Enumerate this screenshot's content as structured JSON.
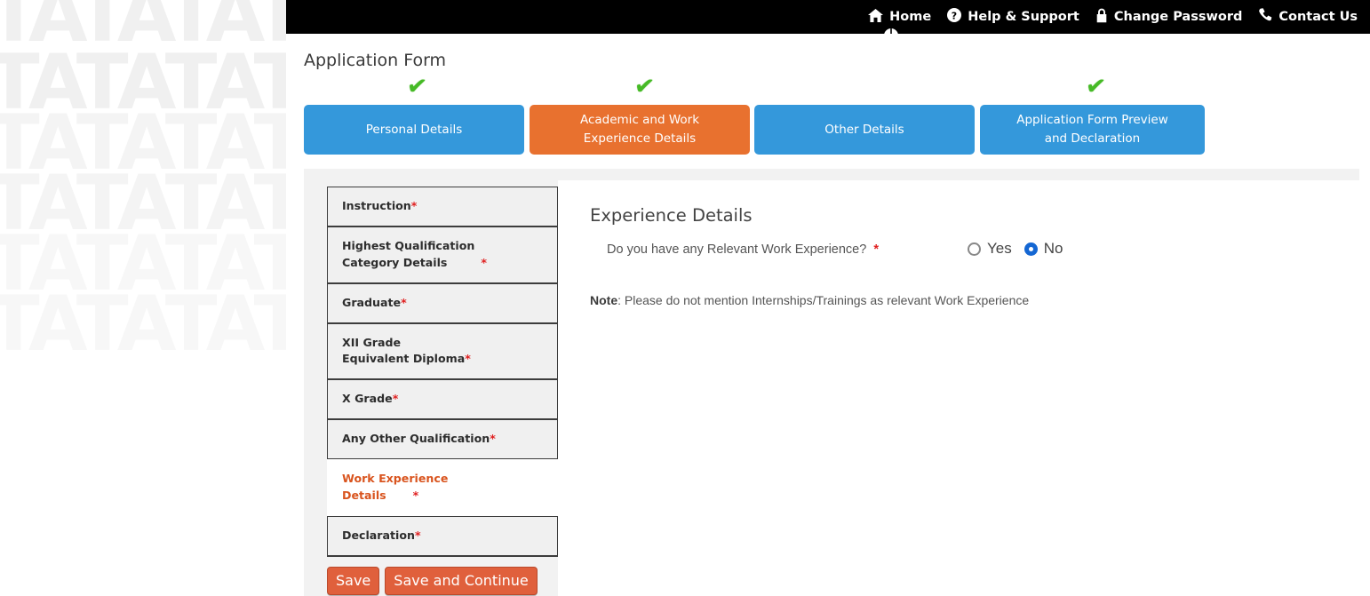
{
  "topbar": {
    "links": [
      {
        "label": "Home",
        "icon": "home-icon"
      },
      {
        "label": "Help & Support",
        "icon": "question-circle-icon"
      },
      {
        "label": "Change Password",
        "icon": "lock-icon"
      },
      {
        "label": "Contact Us",
        "icon": "phone-icon"
      }
    ]
  },
  "page": {
    "title": "Application Form"
  },
  "wizard": {
    "tabs": [
      {
        "label": "Personal Details",
        "state": "blue",
        "checked": true
      },
      {
        "label": "Academic and Work\nExperience Details",
        "state": "orange",
        "checked": true
      },
      {
        "label": "Other Details",
        "state": "blue",
        "checked": false
      },
      {
        "label": "Application Form Preview\nand Declaration",
        "state": "blue",
        "checked": true
      }
    ],
    "check_glyph": "✔"
  },
  "sidebar": {
    "items": [
      {
        "label": "Instruction",
        "required": "*",
        "active": false
      },
      {
        "label": "Highest Qualification\nCategory Details",
        "required": "*",
        "active": false
      },
      {
        "label": "Graduate",
        "required": "*",
        "active": false
      },
      {
        "label": "XII Grade\nEquivalent Diploma",
        "required": "*",
        "active": false
      },
      {
        "label": "X Grade",
        "required": "*",
        "active": false
      },
      {
        "label": "Any Other Qualification",
        "required": "*",
        "active": false
      },
      {
        "label": "Work Experience\nDetails",
        "required": "*",
        "active": true
      },
      {
        "label": "Declaration",
        "required": "*",
        "active": false
      }
    ]
  },
  "buttons": {
    "save": "Save",
    "save_and_continue": "Save and Continue"
  },
  "main": {
    "section_title": "Experience Details",
    "question": "Do you have any Relevant Work Experience?",
    "question_required": "*",
    "options": [
      {
        "label": "Yes",
        "selected": false
      },
      {
        "label": "No",
        "selected": true
      }
    ],
    "note_label": "Note",
    "note_text": ": Please do not mention Internships/Trainings as relevant Work Experience"
  },
  "watermark": {
    "text": "TATATATATATATA"
  },
  "colors": {
    "tab_blue": "#3498db",
    "tab_orange": "#e8712f",
    "check_green": "#46ba26",
    "button_orange": "#e0603c",
    "active_item_text": "#d9541e",
    "required_red": "#e02020",
    "radio_blue": "#1567d3",
    "topbar_black": "#000000",
    "panel_gray": "#f2f2f2"
  }
}
